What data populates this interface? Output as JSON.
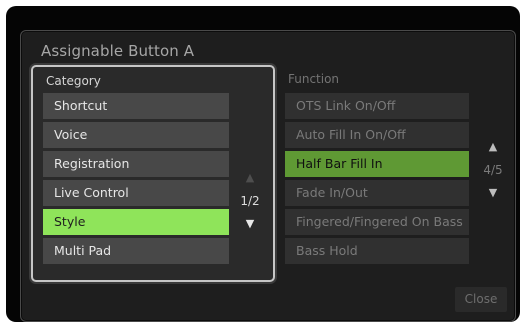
{
  "dialog": {
    "title": "Assignable Button A"
  },
  "category": {
    "label": "Category",
    "items": [
      {
        "label": "Shortcut"
      },
      {
        "label": "Voice"
      },
      {
        "label": "Registration"
      },
      {
        "label": "Live Control"
      },
      {
        "label": "Style"
      },
      {
        "label": "Multi Pad"
      }
    ],
    "selected_index": 4,
    "page": "1/2",
    "up_icon": "triangle-up",
    "down_icon": "triangle-down"
  },
  "function": {
    "label": "Function",
    "items": [
      {
        "label": "OTS Link On/Off"
      },
      {
        "label": "Auto Fill In On/Off"
      },
      {
        "label": "Half Bar Fill In"
      },
      {
        "label": "Fade In/Out"
      },
      {
        "label": "Fingered/Fingered On Bass"
      },
      {
        "label": "Bass Hold"
      }
    ],
    "selected_index": 2,
    "page": "4/5",
    "up_icon": "triangle-up",
    "down_icon": "triangle-down"
  },
  "buttons": {
    "close_label": "Close"
  },
  "colors": {
    "selected_category": "#8fe45a",
    "selected_function": "#5f9934",
    "panel_border": "#c6c6c6",
    "background": "#1e1e1e"
  }
}
